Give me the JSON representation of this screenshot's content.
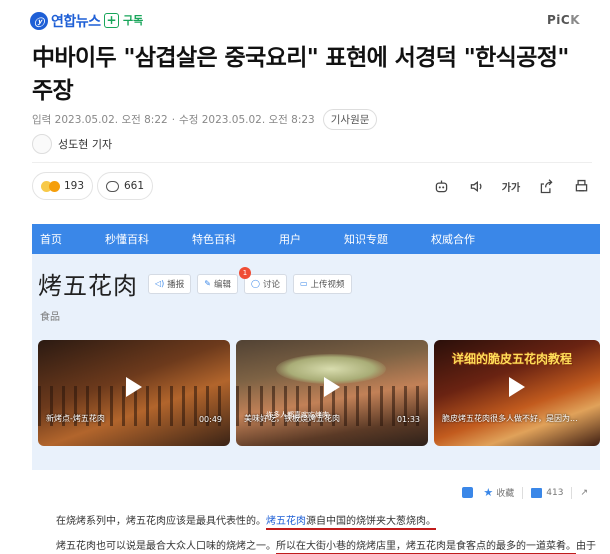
{
  "header": {
    "logo_mark": "ⓨ",
    "logo_text": "연합뉴스",
    "subscribe_label": "구독",
    "pick_label_main": "PiC",
    "pick_label_k": "K"
  },
  "article": {
    "title_line1": "中바이두 \"삼겹살은 중국요리\" 표현에 서경덕 \"한식공정\"",
    "title_line2": "주장",
    "published_label": "입력 2023.05.02. 오전 8:22",
    "modified_label": "수정 2023.05.02. 오전 8:23",
    "original_button": "기사원문",
    "reporter": "성도현 기자",
    "reaction_count": "193",
    "comment_count": "661",
    "font_tool_label": "가가"
  },
  "embed": {
    "nav": [
      "首页",
      "秒懂百科",
      "特色百科",
      "用户",
      "知识专题",
      "权威合作"
    ],
    "title": "烤五花肉",
    "buttons": [
      "播报",
      "编辑",
      "讨论",
      "上传视频"
    ],
    "discuss_badge": "1",
    "category": "食品",
    "videos": [
      {
        "caption": "新烤点-烤五花肉",
        "duration": "00:49"
      },
      {
        "caption": "美味好吃，铁板烧烤五花肉",
        "duration": "01:33",
        "subtitle": "许多人都喜欢吃烤肉"
      },
      {
        "overlay": "详细的脆皮五花肉教程",
        "caption": "脆皮烤五花肉很多人做不好，是因为..."
      }
    ],
    "tools": {
      "favorite": "收藏",
      "likes": "413"
    },
    "paragraph1_a": "在烧烤系列中，烤五花肉应该是最具代表性的。",
    "paragraph1_b": "烤五花肉源自中国的烧饼夹大葱烧肉。",
    "paragraph2_a": "烤五花肉也可以说是最合大众人口味的烧烤之一。",
    "paragraph2_b": "所以在大街小巷的烧烤店里，烤五花肉是食客点的最多的一道菜肴。",
    "paragraph2_c": "由于"
  },
  "colors": {
    "brand": "#1e5fd6",
    "subscribe": "#18a55a",
    "baidu_nav": "#3a87e8",
    "underline": "#c01b1b"
  }
}
